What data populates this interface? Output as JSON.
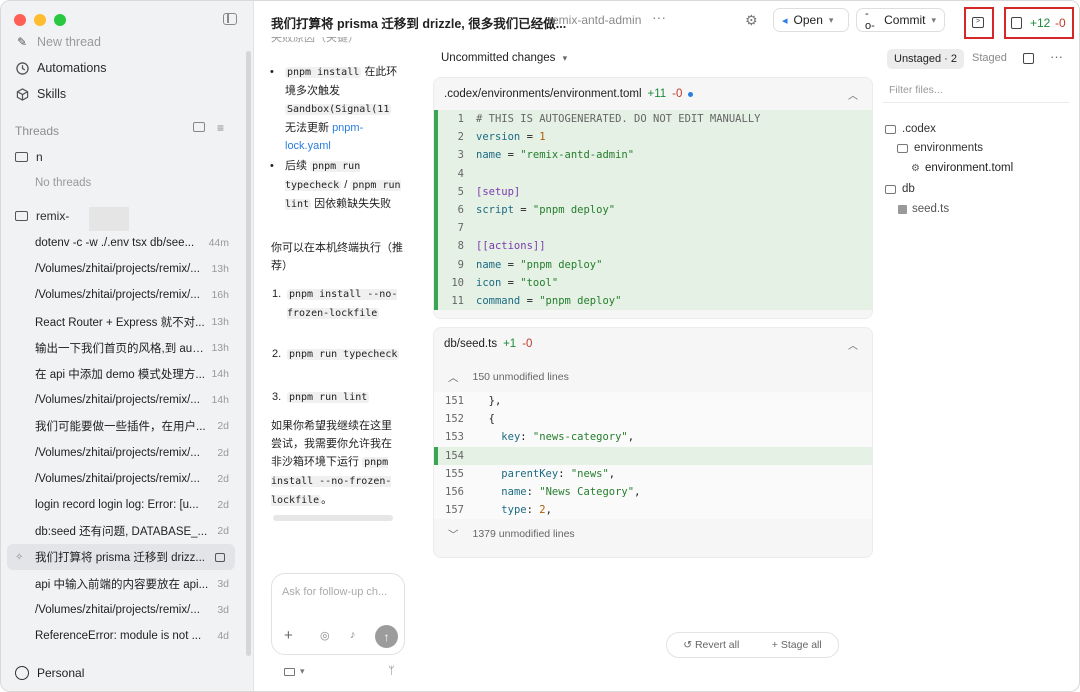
{
  "window": {
    "traffic_colors": [
      "#ff5f57",
      "#febc2e",
      "#28c840"
    ]
  },
  "sidebar": {
    "nav": [
      {
        "icon": "pencil-icon",
        "label": "New thread"
      },
      {
        "icon": "clock-icon",
        "label": "Automations"
      },
      {
        "icon": "cube-icon",
        "label": "Skills"
      }
    ],
    "threads_heading": "Threads",
    "folder_1": {
      "name": "n",
      "empty_text": "No threads"
    },
    "folder_2": {
      "name": "remix-"
    },
    "threads": [
      {
        "title": "dotenv -c -w ./.env tsx db/see...",
        "age": "44m"
      },
      {
        "title": "/Volumes/zhitai/projects/remix/...",
        "age": "13h"
      },
      {
        "title": "/Volumes/zhitai/projects/remix/...",
        "age": "16h"
      },
      {
        "title": "React Router + Express 就不对...",
        "age": "13h"
      },
      {
        "title": "输出一下我们首页的风格,到 aud...",
        "age": "13h"
      },
      {
        "title": "在 api 中添加 demo 模式处理方...",
        "age": "14h"
      },
      {
        "title": "/Volumes/zhitai/projects/remix/...",
        "age": "14h"
      },
      {
        "title": "我们可能要做一些插件，在用户...",
        "age": "2d"
      },
      {
        "title": "/Volumes/zhitai/projects/remix/...",
        "age": "2d"
      },
      {
        "title": "/Volumes/zhitai/projects/remix/...",
        "age": "2d"
      },
      {
        "title": "login record login log: Error: [u...",
        "age": "2d"
      },
      {
        "title": "db:seed 还有问题, DATABASE_...",
        "age": "2d"
      },
      {
        "title": "我们打算将 prisma 迁移到 drizz...",
        "age": ""
      },
      {
        "title": "api 中输入前端的内容要放在 api...",
        "age": "3d"
      },
      {
        "title": "/Volumes/zhitai/projects/remix/...",
        "age": "3d"
      },
      {
        "title": "ReferenceError: module is not ...",
        "age": "4d"
      }
    ],
    "account": "Personal"
  },
  "topbar": {
    "title": "我们打算将 prisma 迁移到 drizzle, 很多我们已经做...",
    "project": "remix-antd-admin",
    "open_label": "Open",
    "commit_label": "Commit",
    "diff_added": "+12",
    "diff_removed": "-0"
  },
  "chat": {
    "cut_heading": "失败原因（关键）",
    "bullet1_code": "pnpm install",
    "bullet1_text1": "在此环境多次触发",
    "bullet1_code2": "Sandbox(Signal(11",
    "bullet1_text2": "无法更新",
    "bullet1_link": "pnpm-lock.yaml",
    "bullet2_text1": "后续",
    "bullet2_code1": "pnpm run typecheck",
    "bullet2_sep": "/",
    "bullet2_code2": "pnpm run lint",
    "bullet2_text2": "因依赖缺失失败",
    "para1": "你可以在本机终端执行（推荐）",
    "steps": [
      "pnpm install --no-frozen-lockfile",
      "pnpm run typecheck",
      "pnpm run lint"
    ],
    "para2": "如果你希望我继续在这里尝试，我需要你允许我在非沙箱环境下运行",
    "para2_code": "pnpm install --no-frozen-lockfile",
    "para2_end": "。",
    "composer_placeholder": "Ask for follow-up ch..."
  },
  "diff": {
    "header": "Uncommitted changes",
    "tab_unstaged": "Unstaged · 2",
    "tab_staged": "Staged",
    "filter_placeholder": "Filter files...",
    "file1": {
      "path": ".codex/environments/environment.toml",
      "added": "+11",
      "removed": "-0"
    },
    "file2": {
      "path": "db/seed.ts",
      "added": "+1",
      "removed": "-0",
      "fold_top": "150 unmodified lines",
      "fold_bottom": "1379 unmodified lines"
    },
    "revert_all": "Revert all",
    "stage_all": "Stage all"
  },
  "tree": {
    "folder_codex": ".codex",
    "folder_envs": "environments",
    "file_env": "environment.toml",
    "folder_db": "db",
    "file_seed": "seed.ts"
  }
}
